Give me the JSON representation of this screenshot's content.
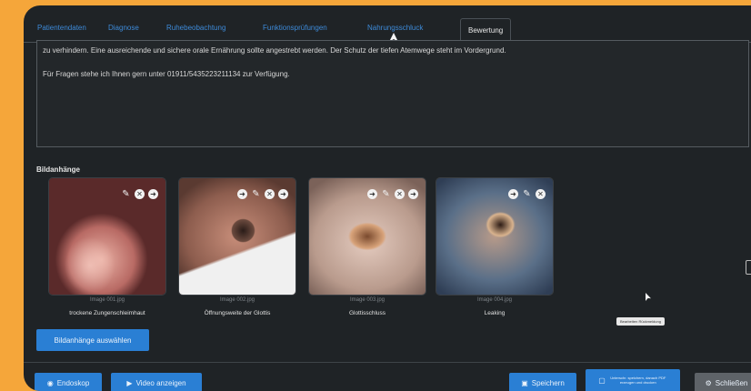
{
  "tabs": [
    {
      "label": "Patientendaten",
      "active": false
    },
    {
      "label": "Diagnose",
      "active": false
    },
    {
      "label": "Ruhebeobachtung",
      "active": false
    },
    {
      "label": "Funktionsprüfungen",
      "active": false
    },
    {
      "label": "Nahrungsschluck",
      "active": false
    },
    {
      "label": "Bewertung",
      "active": true
    }
  ],
  "assessment": {
    "line1": "zu verhindern. Eine ausreichende und sichere orale Ernährung sollte angestrebt werden. Der Schutz der tiefen Atemwege steht im Vordergrund.",
    "line2": "Für Fragen stehe ich Ihnen gern unter 01911/5435223211134 zur Verfügung."
  },
  "attachments": {
    "label": "Bildanhänge",
    "select_button": "Bildanhänge auswählen",
    "items": [
      {
        "filename": "Image 001.jpg",
        "caption": "trockene Zungenschleimhaut"
      },
      {
        "filename": "Image 002.jpg",
        "caption": "Öffnungsweite der Glottis"
      },
      {
        "filename": "Image 003.jpg",
        "caption": "Glottisschluss"
      },
      {
        "filename": "Image 004.jpg",
        "caption": "Leaking"
      }
    ]
  },
  "tooltip": "Bearbeiten Rückmeldung",
  "footer": {
    "endoscope": "Endoskop",
    "video": "Video anzeigen",
    "save": "Speichern",
    "save_pdf": "Unterschr. speichern, danach PDF erzeugen und drucken",
    "close": "Schließen"
  },
  "colors": {
    "accent": "#2a7fd4",
    "background": "#1f2326",
    "outer": "#f5a63a"
  },
  "icons": [
    "edit-icon",
    "close-icon",
    "arrow-icon",
    "camera-icon",
    "video-icon",
    "save-icon",
    "pdf-icon",
    "gear-icon"
  ]
}
